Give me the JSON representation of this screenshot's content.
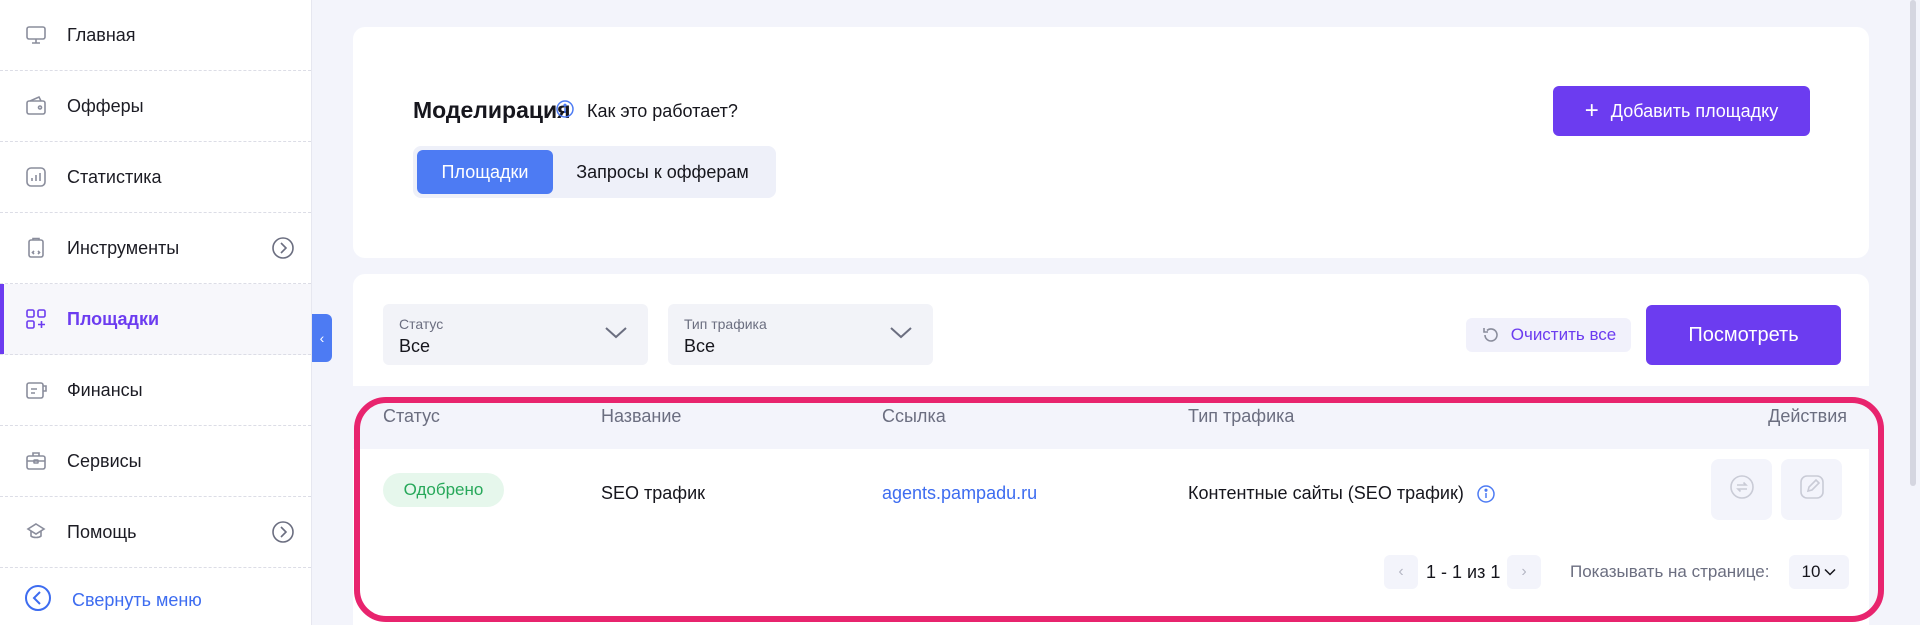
{
  "sidebar": {
    "items": [
      {
        "label": "Главная",
        "icon": "monitor-icon"
      },
      {
        "label": "Офферы",
        "icon": "wallet-icon"
      },
      {
        "label": "Статистика",
        "icon": "chart-icon"
      },
      {
        "label": "Инструменты",
        "icon": "tools-icon",
        "has_arrow": true
      },
      {
        "label": "Площадки",
        "icon": "grid-plus-icon",
        "active": true
      },
      {
        "label": "Финансы",
        "icon": "finance-icon"
      },
      {
        "label": "Сервисы",
        "icon": "briefcase-icon"
      },
      {
        "label": "Помощь",
        "icon": "help-icon",
        "has_arrow": true
      }
    ],
    "collapse_label": "Свернуть меню"
  },
  "header": {
    "title": "Моделирация",
    "how_it_works": "Как это работает?",
    "add_button": "Добавить площадку",
    "tabs": [
      {
        "label": "Площадки",
        "active": true
      },
      {
        "label": "Запросы к офферам",
        "active": false
      }
    ]
  },
  "filters": {
    "status": {
      "caption": "Статус",
      "value": "Все"
    },
    "traffic_type": {
      "caption": "Тип трафика",
      "value": "Все"
    },
    "clear_label": "Очистить все",
    "view_label": "Посмотреть"
  },
  "table": {
    "columns": {
      "status": "Статус",
      "name": "Название",
      "link": "Ссылка",
      "traffic": "Тип трафика",
      "actions": "Действия"
    },
    "rows": [
      {
        "status": "Одобрено",
        "name": "SEO трафик",
        "link": "agents.pampadu.ru",
        "traffic": "Контентные сайты (SEO трафик)"
      }
    ]
  },
  "pagination": {
    "range": "1 - 1 из 1",
    "per_page_label": "Показывать на странице:",
    "per_page_value": "10"
  },
  "colors": {
    "accent": "#6c3cf0",
    "blue": "#4d7bf3",
    "success": "#27a85a",
    "highlight": "#e8246e"
  }
}
